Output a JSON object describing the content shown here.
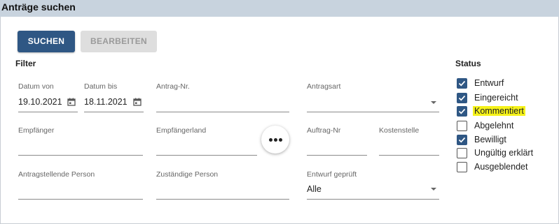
{
  "window": {
    "title": "Anträge suchen"
  },
  "toolbar": {
    "search_label": "SUCHEN",
    "edit_label": "BEARBEITEN"
  },
  "filter": {
    "heading": "Filter",
    "datum_von": {
      "label": "Datum von",
      "value": "19.10.2021"
    },
    "datum_bis": {
      "label": "Datum bis",
      "value": "18.11.2021"
    },
    "antrag_nr": {
      "label": "Antrag-Nr.",
      "value": ""
    },
    "antragsart": {
      "label": "Antragsart",
      "value": ""
    },
    "empfaenger": {
      "label": "Empfänger",
      "value": ""
    },
    "empfaengerland": {
      "label": "Empfängerland",
      "value": ""
    },
    "auftrag_nr": {
      "label": "Auftrag-Nr",
      "value": ""
    },
    "kostenstelle": {
      "label": "Kostenstelle",
      "value": ""
    },
    "antragstellende_person": {
      "label": "Antragstellende Person",
      "value": ""
    },
    "zustaendige_person": {
      "label": "Zuständige Person",
      "value": ""
    },
    "entwurf_geprueft": {
      "label": "Entwurf geprüft",
      "value": "Alle"
    }
  },
  "status": {
    "heading": "Status",
    "items": [
      {
        "label": "Entwurf",
        "checked": true
      },
      {
        "label": "Eingereicht",
        "checked": true
      },
      {
        "label": "Kommentiert",
        "checked": true,
        "highlight": "#f5f21a"
      },
      {
        "label": "Abgelehnt",
        "checked": false
      },
      {
        "label": "Bewilligt",
        "checked": true
      },
      {
        "label": "Ungültig erklärt",
        "checked": false
      },
      {
        "label": "Ausgeblendet",
        "checked": false
      }
    ]
  },
  "colors": {
    "accent": "#2f5784",
    "titlebar": "#c8d3de",
    "highlight": "#f5f21a"
  },
  "icons": [
    "calendar-icon",
    "dropdown-arrow-icon",
    "more-icon",
    "checkmark-icon"
  ]
}
